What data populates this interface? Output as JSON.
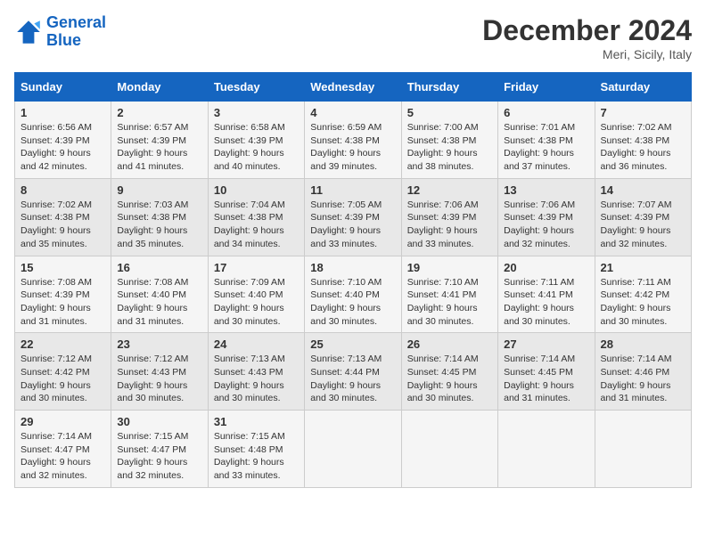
{
  "logo": {
    "line1": "General",
    "line2": "Blue"
  },
  "title": "December 2024",
  "location": "Meri, Sicily, Italy",
  "days_header": [
    "Sunday",
    "Monday",
    "Tuesday",
    "Wednesday",
    "Thursday",
    "Friday",
    "Saturday"
  ],
  "weeks": [
    [
      {
        "day": "1",
        "sunrise": "6:56 AM",
        "sunset": "4:39 PM",
        "daylight": "9 hours and 42 minutes."
      },
      {
        "day": "2",
        "sunrise": "6:57 AM",
        "sunset": "4:39 PM",
        "daylight": "9 hours and 41 minutes."
      },
      {
        "day": "3",
        "sunrise": "6:58 AM",
        "sunset": "4:39 PM",
        "daylight": "9 hours and 40 minutes."
      },
      {
        "day": "4",
        "sunrise": "6:59 AM",
        "sunset": "4:38 PM",
        "daylight": "9 hours and 39 minutes."
      },
      {
        "day": "5",
        "sunrise": "7:00 AM",
        "sunset": "4:38 PM",
        "daylight": "9 hours and 38 minutes."
      },
      {
        "day": "6",
        "sunrise": "7:01 AM",
        "sunset": "4:38 PM",
        "daylight": "9 hours and 37 minutes."
      },
      {
        "day": "7",
        "sunrise": "7:02 AM",
        "sunset": "4:38 PM",
        "daylight": "9 hours and 36 minutes."
      }
    ],
    [
      {
        "day": "8",
        "sunrise": "7:02 AM",
        "sunset": "4:38 PM",
        "daylight": "9 hours and 35 minutes."
      },
      {
        "day": "9",
        "sunrise": "7:03 AM",
        "sunset": "4:38 PM",
        "daylight": "9 hours and 35 minutes."
      },
      {
        "day": "10",
        "sunrise": "7:04 AM",
        "sunset": "4:38 PM",
        "daylight": "9 hours and 34 minutes."
      },
      {
        "day": "11",
        "sunrise": "7:05 AM",
        "sunset": "4:39 PM",
        "daylight": "9 hours and 33 minutes."
      },
      {
        "day": "12",
        "sunrise": "7:06 AM",
        "sunset": "4:39 PM",
        "daylight": "9 hours and 33 minutes."
      },
      {
        "day": "13",
        "sunrise": "7:06 AM",
        "sunset": "4:39 PM",
        "daylight": "9 hours and 32 minutes."
      },
      {
        "day": "14",
        "sunrise": "7:07 AM",
        "sunset": "4:39 PM",
        "daylight": "9 hours and 32 minutes."
      }
    ],
    [
      {
        "day": "15",
        "sunrise": "7:08 AM",
        "sunset": "4:39 PM",
        "daylight": "9 hours and 31 minutes."
      },
      {
        "day": "16",
        "sunrise": "7:08 AM",
        "sunset": "4:40 PM",
        "daylight": "9 hours and 31 minutes."
      },
      {
        "day": "17",
        "sunrise": "7:09 AM",
        "sunset": "4:40 PM",
        "daylight": "9 hours and 30 minutes."
      },
      {
        "day": "18",
        "sunrise": "7:10 AM",
        "sunset": "4:40 PM",
        "daylight": "9 hours and 30 minutes."
      },
      {
        "day": "19",
        "sunrise": "7:10 AM",
        "sunset": "4:41 PM",
        "daylight": "9 hours and 30 minutes."
      },
      {
        "day": "20",
        "sunrise": "7:11 AM",
        "sunset": "4:41 PM",
        "daylight": "9 hours and 30 minutes."
      },
      {
        "day": "21",
        "sunrise": "7:11 AM",
        "sunset": "4:42 PM",
        "daylight": "9 hours and 30 minutes."
      }
    ],
    [
      {
        "day": "22",
        "sunrise": "7:12 AM",
        "sunset": "4:42 PM",
        "daylight": "9 hours and 30 minutes."
      },
      {
        "day": "23",
        "sunrise": "7:12 AM",
        "sunset": "4:43 PM",
        "daylight": "9 hours and 30 minutes."
      },
      {
        "day": "24",
        "sunrise": "7:13 AM",
        "sunset": "4:43 PM",
        "daylight": "9 hours and 30 minutes."
      },
      {
        "day": "25",
        "sunrise": "7:13 AM",
        "sunset": "4:44 PM",
        "daylight": "9 hours and 30 minutes."
      },
      {
        "day": "26",
        "sunrise": "7:14 AM",
        "sunset": "4:45 PM",
        "daylight": "9 hours and 30 minutes."
      },
      {
        "day": "27",
        "sunrise": "7:14 AM",
        "sunset": "4:45 PM",
        "daylight": "9 hours and 31 minutes."
      },
      {
        "day": "28",
        "sunrise": "7:14 AM",
        "sunset": "4:46 PM",
        "daylight": "9 hours and 31 minutes."
      }
    ],
    [
      {
        "day": "29",
        "sunrise": "7:14 AM",
        "sunset": "4:47 PM",
        "daylight": "9 hours and 32 minutes."
      },
      {
        "day": "30",
        "sunrise": "7:15 AM",
        "sunset": "4:47 PM",
        "daylight": "9 hours and 32 minutes."
      },
      {
        "day": "31",
        "sunrise": "7:15 AM",
        "sunset": "4:48 PM",
        "daylight": "9 hours and 33 minutes."
      },
      null,
      null,
      null,
      null
    ]
  ],
  "labels": {
    "sunrise": "Sunrise:",
    "sunset": "Sunset:",
    "daylight": "Daylight:"
  }
}
